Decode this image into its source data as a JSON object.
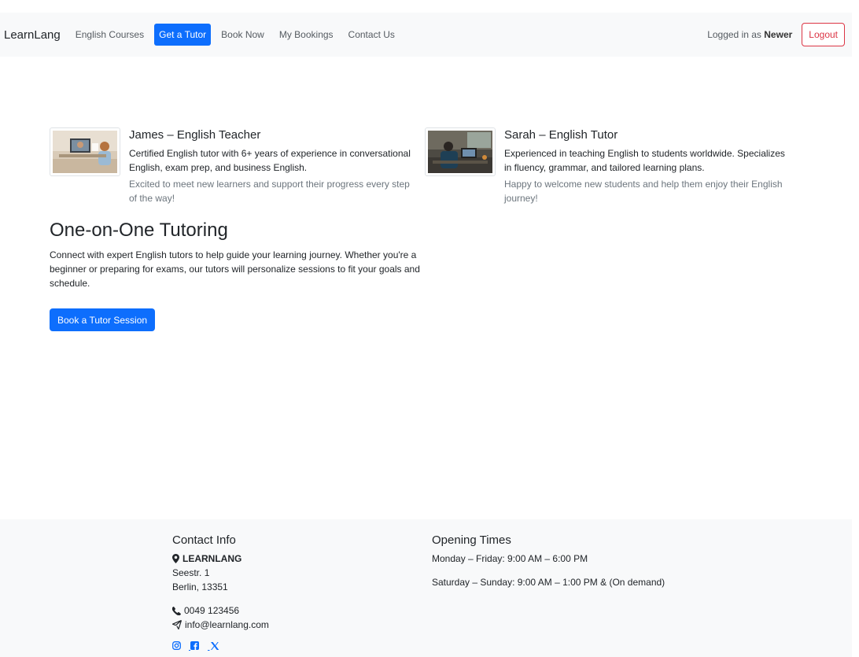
{
  "nav": {
    "brand": "LearnLang",
    "links": [
      "English Courses",
      "Get a Tutor",
      "Book Now",
      "My Bookings",
      "Contact Us"
    ],
    "active_link": "Get a Tutor",
    "logged_prefix": "Logged in as",
    "username": "Newer",
    "logout_label": "Logout"
  },
  "tutors": [
    {
      "name": "James – English Teacher",
      "description": "Certified English tutor with 6+ years of experience in conversational English, exam prep, and business English.",
      "note": "Excited to meet new learners and support their progress every step of the way!"
    },
    {
      "name": "Sarah – English Tutor",
      "description": "Experienced in teaching English to students worldwide. Specializes in fluency, grammar, and tailored learning plans.",
      "note": "Happy to welcome new students and help them enjoy their English journey!"
    }
  ],
  "hero": {
    "title": "One-on-One Tutoring",
    "text": "Connect with expert English tutors to help guide your learning journey. Whether you're a beginner or preparing for exams, our tutors will personalize sessions to fit your goals and schedule.",
    "button_label": "Book a Tutor Session"
  },
  "footer": {
    "contact": {
      "heading": "Contact Info",
      "company": "LEARNLANG",
      "street": "Seestr. 1",
      "city": "Berlin, 13351",
      "phone": "0049 123456",
      "email": "info@learnlang.com"
    },
    "hours": {
      "heading": "Opening Times",
      "weekdays": "Monday – Friday: 9:00 AM – 6:00 PM",
      "weekend": "Saturday – Sunday: 9:00 AM – 1:00 PM & (On demand)"
    },
    "socials": [
      "instagram-icon",
      "facebook-icon",
      "x-icon"
    ]
  },
  "colors": {
    "primary": "#0d6efd",
    "danger": "#dc3545",
    "light_bg": "#f8f9fa",
    "muted": "#6c757d"
  }
}
